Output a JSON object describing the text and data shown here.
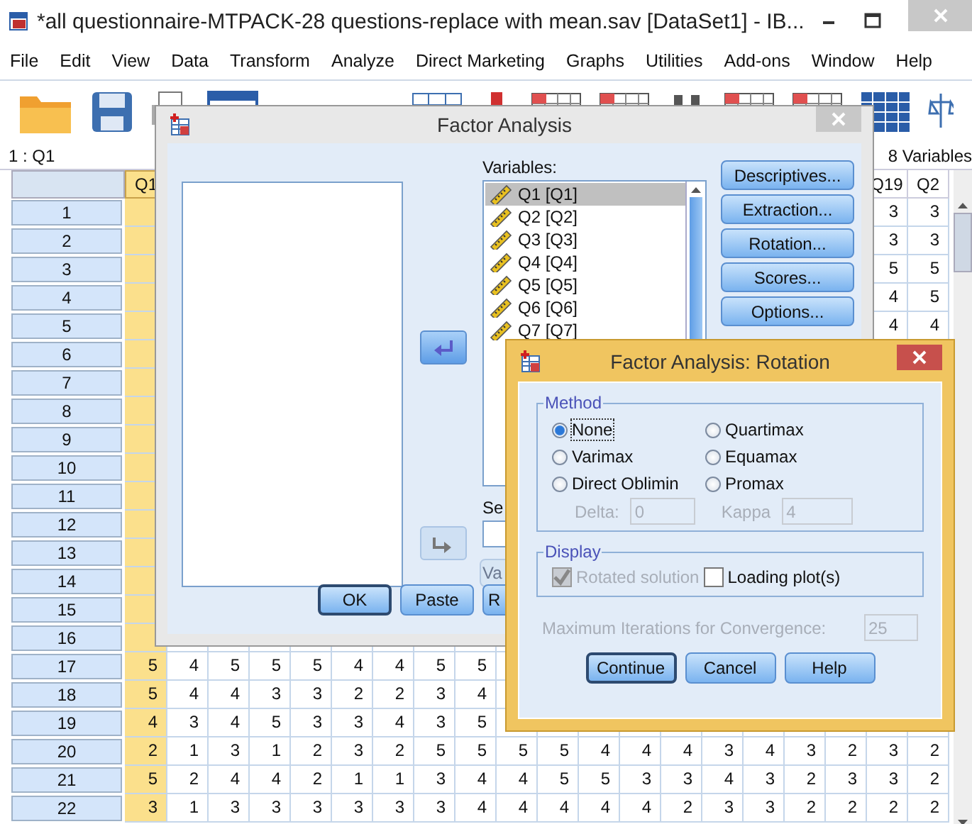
{
  "window": {
    "title": "*all questionnaire-MTPACK-28 questions-replace with mean.sav [DataSet1] - IB..."
  },
  "menu": [
    "File",
    "Edit",
    "View",
    "Data",
    "Transform",
    "Analyze",
    "Direct Marketing",
    "Graphs",
    "Utilities",
    "Add-ons",
    "Window",
    "Help"
  ],
  "toolbar": [
    {
      "kind": "folder"
    },
    {
      "kind": "save"
    },
    {
      "kind": "print"
    },
    {
      "kind": "window"
    },
    {
      "kind": "blank"
    },
    {
      "kind": "blank"
    },
    {
      "kind": "chart"
    },
    {
      "kind": "marker"
    },
    {
      "kind": "grid"
    },
    {
      "kind": "grid"
    },
    {
      "kind": "binoculars"
    },
    {
      "kind": "grid"
    },
    {
      "kind": "grid"
    },
    {
      "kind": "table"
    },
    {
      "kind": "scale"
    }
  ],
  "cell_ref": "1 : Q1",
  "variables_count": "8 Variables",
  "grid": {
    "columns": [
      {
        "label": "Q1",
        "selected": true
      },
      {
        "selected": false
      },
      {
        "selected": false
      },
      {
        "selected": false
      },
      {
        "selected": false
      },
      {
        "selected": false
      },
      {
        "selected": false
      },
      {
        "selected": false
      },
      {
        "selected": false
      },
      {
        "selected": false
      },
      {
        "selected": false
      },
      {
        "selected": false
      },
      {
        "selected": false
      },
      {
        "selected": false
      },
      {
        "selected": false
      },
      {
        "selected": false
      },
      {
        "selected": false
      },
      {
        "selected": false
      },
      {
        "label": "Q19",
        "selected": false
      },
      {
        "label": "Q2",
        "selected": false
      }
    ],
    "rows": [
      {
        "label": "1",
        "cells": [
          null,
          null,
          null,
          null,
          null,
          null,
          null,
          null,
          null,
          null,
          null,
          null,
          null,
          null,
          null,
          null,
          null,
          null,
          "3",
          "3"
        ]
      },
      {
        "label": "2",
        "cells": [
          null,
          null,
          null,
          null,
          null,
          null,
          null,
          null,
          null,
          null,
          null,
          null,
          null,
          null,
          null,
          null,
          null,
          null,
          "3",
          "3"
        ]
      },
      {
        "label": "3",
        "cells": [
          null,
          null,
          null,
          null,
          null,
          null,
          null,
          null,
          null,
          null,
          null,
          null,
          null,
          null,
          null,
          null,
          null,
          null,
          "5",
          "5"
        ]
      },
      {
        "label": "4",
        "cells": [
          null,
          null,
          null,
          null,
          null,
          null,
          null,
          null,
          null,
          null,
          null,
          null,
          null,
          null,
          null,
          null,
          null,
          null,
          "4",
          "5"
        ]
      },
      {
        "label": "5",
        "cells": [
          null,
          null,
          null,
          null,
          null,
          null,
          null,
          null,
          null,
          null,
          null,
          null,
          null,
          null,
          null,
          null,
          null,
          null,
          "4",
          "4"
        ]
      },
      {
        "label": "6",
        "cells": []
      },
      {
        "label": "7",
        "cells": []
      },
      {
        "label": "8",
        "cells": []
      },
      {
        "label": "9",
        "cells": []
      },
      {
        "label": "10",
        "cells": []
      },
      {
        "label": "11",
        "cells": []
      },
      {
        "label": "12",
        "cells": []
      },
      {
        "label": "13",
        "cells": []
      },
      {
        "label": "14",
        "cells": []
      },
      {
        "label": "15",
        "cells": []
      },
      {
        "label": "16",
        "cells": []
      },
      {
        "label": "17",
        "cells": [
          "5",
          "4",
          "5",
          "5",
          "5",
          "4",
          "4",
          "5",
          "5"
        ]
      },
      {
        "label": "18",
        "cells": [
          "5",
          "4",
          "4",
          "3",
          "3",
          "2",
          "2",
          "3",
          "4"
        ]
      },
      {
        "label": "19",
        "cells": [
          "4",
          "3",
          "4",
          "5",
          "3",
          "3",
          "4",
          "3",
          "5"
        ]
      },
      {
        "label": "20",
        "cells": [
          "2",
          "1",
          "3",
          "1",
          "2",
          "3",
          "2",
          "5",
          "5",
          "5",
          "5",
          "4",
          "4",
          "4",
          "3",
          "4",
          "3",
          "2",
          "3",
          "2"
        ]
      },
      {
        "label": "21",
        "cells": [
          "5",
          "2",
          "4",
          "4",
          "2",
          "1",
          "1",
          "3",
          "4",
          "4",
          "5",
          "5",
          "3",
          "3",
          "4",
          "3",
          "2",
          "3",
          "3",
          "2"
        ]
      },
      {
        "label": "22",
        "cells": [
          "3",
          "1",
          "3",
          "3",
          "3",
          "3",
          "3",
          "3",
          "4",
          "4",
          "4",
          "4",
          "4",
          "2",
          "3",
          "3",
          "2",
          "2",
          "2",
          "2"
        ]
      }
    ]
  },
  "factor_dialog": {
    "title": "Factor Analysis",
    "variables_label": "Variables:",
    "variables": [
      {
        "label": "Q1 [Q1]",
        "selected": true
      },
      {
        "label": "Q2 [Q2]",
        "selected": false
      },
      {
        "label": "Q3 [Q3]",
        "selected": false
      },
      {
        "label": "Q4 [Q4]",
        "selected": false
      },
      {
        "label": "Q5 [Q5]",
        "selected": false
      },
      {
        "label": "Q6 [Q6]",
        "selected": false
      },
      {
        "label": "Q7 [Q7]",
        "selected": false
      }
    ],
    "arrow_buttons": [
      {
        "disabled": false
      },
      {
        "disabled": true
      }
    ],
    "side_buttons": [
      "Descriptives...",
      "Extraction...",
      "Rotation...",
      "Scores...",
      "Options..."
    ],
    "selection_label": "Se",
    "partial_button": {
      "label": "Va",
      "disabled": true
    },
    "bottom_buttons": [
      {
        "label": "OK",
        "default": true
      },
      {
        "label": "Paste",
        "default": false
      },
      {
        "label": "R",
        "default": false
      }
    ]
  },
  "rotation_dialog": {
    "title": "Factor Analysis: Rotation",
    "method": {
      "label": "Method",
      "options": [
        {
          "label": "None",
          "selected": true,
          "focused": true
        },
        {
          "label": "Quartimax",
          "selected": false,
          "focused": false
        },
        {
          "label": "Varimax",
          "selected": false,
          "focused": false
        },
        {
          "label": "Equamax",
          "selected": false,
          "focused": false
        },
        {
          "label": "Direct Oblimin",
          "selected": false,
          "focused": false
        },
        {
          "label": "Promax",
          "selected": false,
          "focused": false
        }
      ],
      "params": [
        {
          "label": "Delta:",
          "value": "0",
          "disabled": true
        },
        {
          "label": "Kappa",
          "value": "4",
          "disabled": true
        }
      ]
    },
    "display": {
      "label": "Display",
      "options": [
        {
          "label": "Rotated solution",
          "checked": true,
          "disabled": true
        },
        {
          "label": "Loading plot(s)",
          "checked": false,
          "disabled": false
        }
      ]
    },
    "max_iterations": {
      "label": "Maximum Iterations for Convergence:",
      "value": "25",
      "disabled": true
    },
    "buttons": [
      {
        "label": "Continue",
        "default": true
      },
      {
        "label": "Cancel",
        "default": false
      },
      {
        "label": "Help",
        "default": false
      }
    ]
  }
}
